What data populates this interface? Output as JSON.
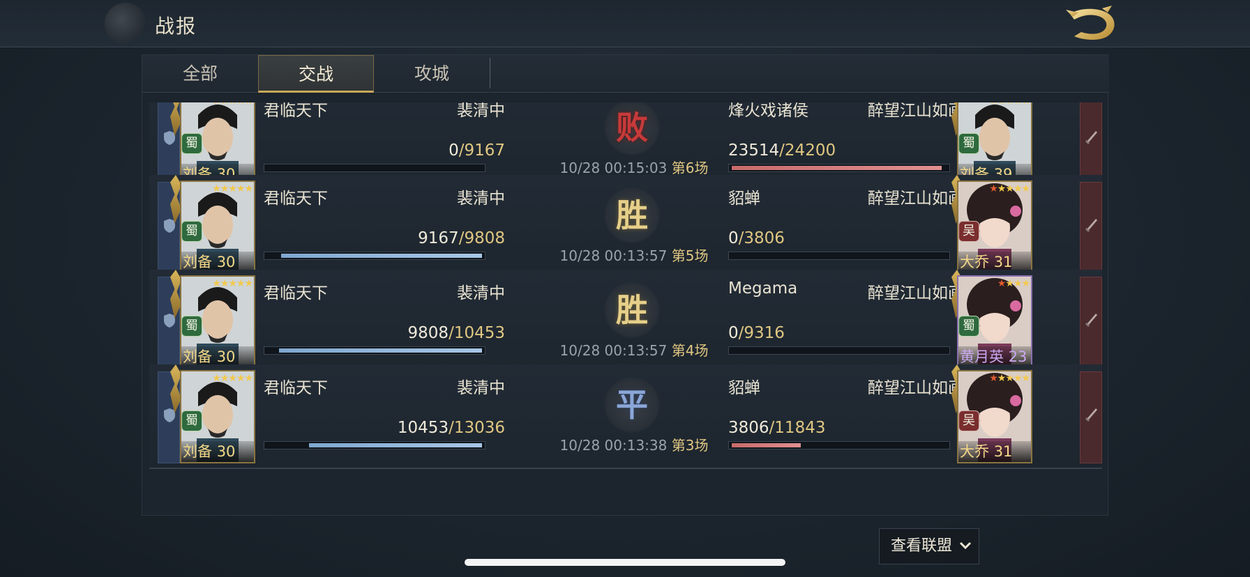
{
  "header": {
    "title": "战报"
  },
  "tabs": [
    {
      "label": "全部",
      "active": false
    },
    {
      "label": "交战",
      "active": true
    },
    {
      "label": "攻城",
      "active": false
    }
  ],
  "reports": [
    {
      "result": "败",
      "result_type": "lose",
      "time": "10/28 00:15:03",
      "round": "第6场",
      "left": {
        "alliance": "君临天下",
        "player": "裴清中",
        "hero": "刘备",
        "level": "30",
        "faction": "蜀",
        "troops": "0",
        "troops_max": "9167",
        "fill_ratio": 0.0,
        "stars": 5,
        "red_stars": 0
      },
      "right": {
        "player": "烽火戏诸侯",
        "alliance": "醉望江山如画",
        "hero": "刘备",
        "level": "39",
        "faction": "蜀",
        "troops": "23514",
        "troops_max": "24200",
        "fill_ratio": 0.97,
        "stars": 5,
        "red_stars": 0
      }
    },
    {
      "result": "胜",
      "result_type": "win",
      "time": "10/28 00:13:57",
      "round": "第5场",
      "left": {
        "alliance": "君临天下",
        "player": "裴清中",
        "hero": "刘备",
        "level": "30",
        "faction": "蜀",
        "troops": "9167",
        "troops_max": "9808",
        "fill_ratio": 0.93,
        "stars": 5,
        "red_stars": 0
      },
      "right": {
        "player": "貂蝉",
        "alliance": "醉望江山如画",
        "hero": "大乔",
        "level": "31",
        "faction": "吴",
        "troops": "0",
        "troops_max": "3806",
        "fill_ratio": 0.0,
        "stars": 5,
        "red_stars": 1
      }
    },
    {
      "result": "胜",
      "result_type": "win",
      "time": "10/28 00:13:57",
      "round": "第4场",
      "left": {
        "alliance": "君临天下",
        "player": "裴清中",
        "hero": "刘备",
        "level": "30",
        "faction": "蜀",
        "troops": "9808",
        "troops_max": "10453",
        "fill_ratio": 0.94,
        "stars": 5,
        "red_stars": 0
      },
      "right": {
        "player": "Megama",
        "alliance": "醉望江山如画",
        "hero": "黄月英",
        "level": "23",
        "faction": "蜀",
        "troops": "0",
        "troops_max": "9316",
        "fill_ratio": 0.0,
        "stars": 4,
        "red_stars": 1
      }
    },
    {
      "result": "平",
      "result_type": "draw",
      "time": "10/28 00:13:38",
      "round": "第3场",
      "left": {
        "alliance": "君临天下",
        "player": "裴清中",
        "hero": "刘备",
        "level": "30",
        "faction": "蜀",
        "troops": "10453",
        "troops_max": "13036",
        "fill_ratio": 0.8,
        "stars": 5,
        "red_stars": 0
      },
      "right": {
        "player": "貂蝉",
        "alliance": "醉望江山如画",
        "hero": "大乔",
        "level": "31",
        "faction": "吴",
        "troops": "3806",
        "troops_max": "11843",
        "fill_ratio": 0.32,
        "stars": 5,
        "red_stars": 1
      }
    }
  ],
  "footer": {
    "alliance_button": "查看联盟"
  },
  "colors": {
    "gold": "#e0c782",
    "win": "#e6cf8a",
    "lose": "#c73a3a",
    "draw": "#8aa6d8",
    "blue_bar": "#a7c6e6",
    "red_bar": "#e09090"
  }
}
